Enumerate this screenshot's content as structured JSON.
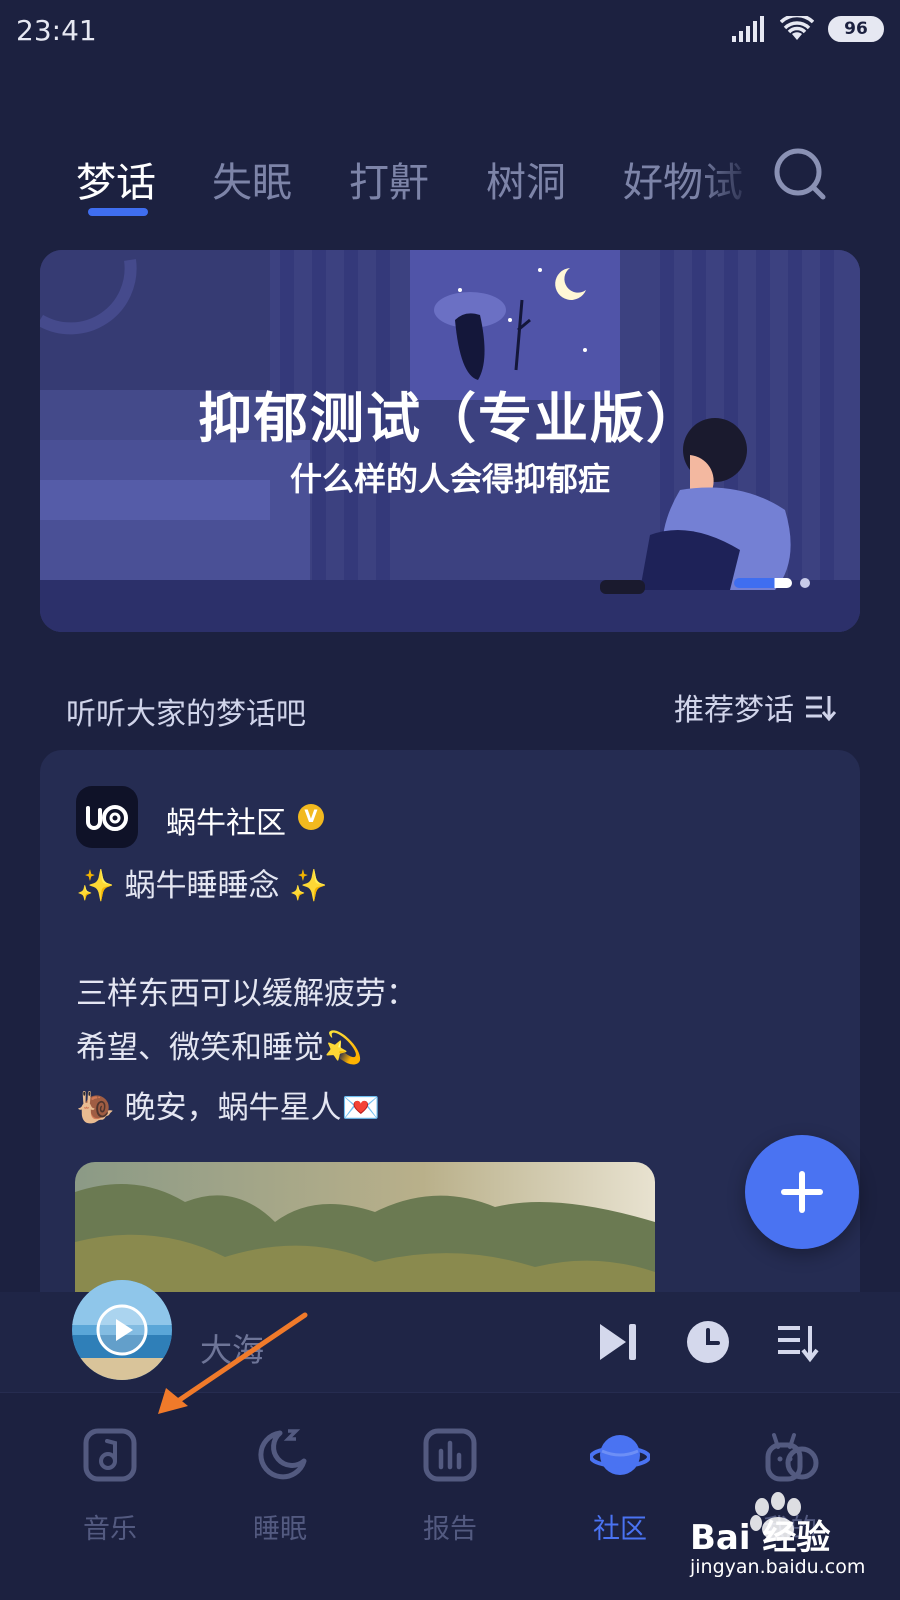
{
  "status_bar": {
    "time": "23:41",
    "battery": "96"
  },
  "tabs": [
    {
      "label": "梦话",
      "active": true
    },
    {
      "label": "失眠",
      "active": false
    },
    {
      "label": "打鼾",
      "active": false
    },
    {
      "label": "树洞",
      "active": false
    },
    {
      "label": "好物试",
      "active": false
    }
  ],
  "banner": {
    "title": "抑郁测试（专业版）",
    "subtitle": "什么样的人会得抑郁症",
    "slide_count": 2,
    "active_slide": 1
  },
  "section": {
    "title": "听听大家的梦话吧",
    "sort_label": "推荐梦话"
  },
  "post": {
    "author": "蜗牛社区",
    "badge": "V",
    "lines": [
      "✨ 蜗牛睡睡念 ✨",
      "三样东西可以缓解疲劳：",
      "希望、微笑和睡觉💫",
      "🐌 晚安，蜗牛星人💌"
    ]
  },
  "player": {
    "title": "大海"
  },
  "bottom_nav": [
    {
      "label": "音乐",
      "icon": "music-note-icon",
      "active": false
    },
    {
      "label": "睡眠",
      "icon": "moon-icon",
      "active": false
    },
    {
      "label": "报告",
      "icon": "bar-chart-icon",
      "active": false
    },
    {
      "label": "社区",
      "icon": "planet-icon",
      "active": true
    },
    {
      "label": "我的",
      "icon": "snail-icon",
      "active": false
    }
  ],
  "watermark": {
    "text": "Bai 经验",
    "url": "jingyan.baidu.com"
  },
  "colors": {
    "background": "#1c2140",
    "accent": "#4a73f2",
    "card": "#252c52",
    "annotation_arrow": "#f07a2a"
  }
}
